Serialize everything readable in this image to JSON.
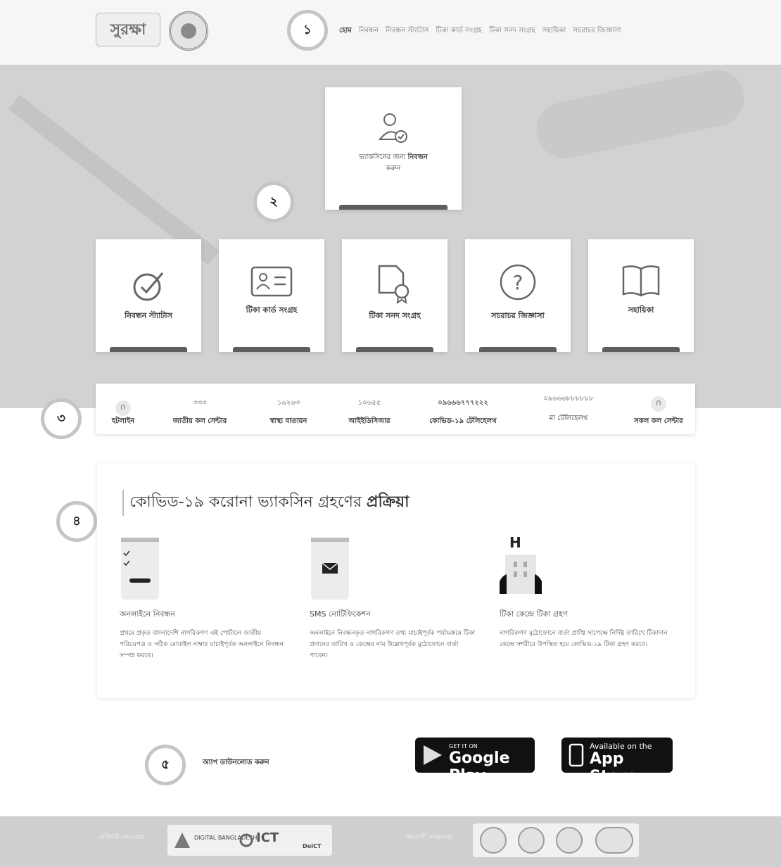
{
  "header": {
    "logo_text": "সুরক্ষা",
    "marker": "১",
    "nav": [
      "হোম",
      "নিবন্ধন",
      "নিবন্ধন স্ট্যাটাস",
      "টিকা কার্ড সংগ্রহ",
      "টিকা সনদ সংগ্রহ",
      "সহায়িকা",
      "সচরাচর জিজ্ঞাসা"
    ]
  },
  "hero": {
    "marker": "২",
    "register_card": {
      "line1": "ভ্যাকসিনের জন্য",
      "line1_bold": "নিবন্ধন",
      "line2": "করুন"
    },
    "tiles": [
      {
        "label": "নিবন্ধন স্ট্যাটাস",
        "icon": "check-circle-icon"
      },
      {
        "label": "টিকা কার্ড সংগ্রহ",
        "icon": "id-card-icon"
      },
      {
        "label": "টিকা সনদ সংগ্রহ",
        "icon": "certificate-icon"
      },
      {
        "label": "সচরাচর জিজ্ঞাসা",
        "icon": "question-icon"
      },
      {
        "label": "সহায়িকা",
        "icon": "book-icon"
      }
    ]
  },
  "helpline": {
    "marker": "৩",
    "items": [
      {
        "number": "",
        "label": "হটলাইন"
      },
      {
        "number": "৩৩৩",
        "label": "জাতীয় কল সেন্টার"
      },
      {
        "number": "১৬২৬৩",
        "label": "স্বাস্থ্য বাতায়ন"
      },
      {
        "number": "১০৬৫৫",
        "label": "আইইডিসিআর"
      },
      {
        "number": "০৯৬৬৬৭৭৭২২২",
        "label": "কোভিড-১৯ টেলিহেলথ"
      },
      {
        "number": "০৯৬৬৬৮৮৮৮৮৮",
        "label": "মা টেলিহেলথ"
      },
      {
        "number": "",
        "label": "সকল কল সেন্টার"
      }
    ]
  },
  "process": {
    "marker": "৪",
    "title_pre": "কোভিড-১৯ করোনা ভ্যাকসিন গ্রহণের ",
    "title_bold": "প্রক্রিয়া",
    "steps": [
      {
        "title": "অনলাইনে নিবন্ধন",
        "desc": "প্রথমে প্রকৃত বাংলাদেশি নাগরিকগণ এই পোর্টালে জাতীয় পরিচয়পত্র ও সঠিক মোবাইল নাম্বার যাচাইপূর্বক অনলাইনে নিবন্ধন সম্পন্ন করবে।"
      },
      {
        "title": "SMS নোটিফিকেশন",
        "desc": "অনলাইনে নিবন্ধনকৃত নাগরিকগণ তথ্য যাচাইপূর্বক পর্যায়ক্রমে টিকা প্রদানের তারিখ ও কেন্দ্রের নাম উল্লেখপূর্বক মুঠোফোনে বার্তা পাবেন।"
      },
      {
        "title": "টিকা কেন্দ্রে টিকা গ্রহণ",
        "desc": "নাগরিকগণ মুঠোফোনে বার্তা প্রাপ্তি সাপেক্ষে নির্দিষ্ট তারিখে টিকাদান কেন্দ্রে সশরীরে উপস্থিত হয়ে কোভিড-১৯ টিকা গ্রহণ করবে।"
      }
    ]
  },
  "app": {
    "marker": "৫",
    "label": "অ্যাপ ডাউনলোড করুন",
    "google_small": "GET IT ON",
    "google_big": "Google Play",
    "apple_small": "Available on the",
    "apple_big": "App Store"
  },
  "footer": {
    "tech_label": "কারিগরি সহায়তায় -",
    "partner_label": "সহযোগী সংস্থাসমূহ -",
    "logo1": "DIGITAL BANGLADESH",
    "logo2": "ICT",
    "logo3": "DoICT"
  },
  "colors": {
    "dark_bar": "#5e5e5e",
    "hero_bg": "#d2d2d2",
    "footer_bg": "#cfcfcf"
  }
}
